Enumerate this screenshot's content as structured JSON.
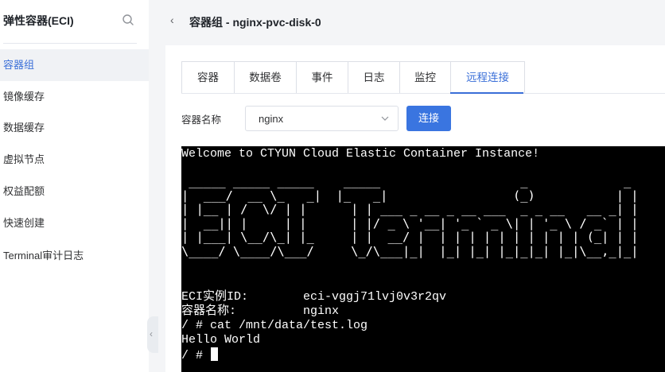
{
  "sidebar": {
    "title": "弹性容器(ECI)",
    "items": [
      {
        "label": "容器组",
        "active": true
      },
      {
        "label": "镜像缓存",
        "active": false
      },
      {
        "label": "数据缓存",
        "active": false
      },
      {
        "label": "虚拟节点",
        "active": false
      },
      {
        "label": "权益配额",
        "active": false
      },
      {
        "label": "快速创建",
        "active": false
      },
      {
        "label": "Terminal审计日志",
        "active": false
      }
    ]
  },
  "header": {
    "title": "容器组 - nginx-pvc-disk-0"
  },
  "tabs": [
    {
      "label": "容器"
    },
    {
      "label": "数据卷"
    },
    {
      "label": "事件"
    },
    {
      "label": "日志"
    },
    {
      "label": "监控"
    },
    {
      "label": "远程连接"
    }
  ],
  "container_select": {
    "label": "容器名称",
    "value": "nginx"
  },
  "connect_button": {
    "label": "连接"
  },
  "terminal": {
    "welcome": "Welcome to CTYUN Cloud Elastic Container Instance!",
    "banner": " _____ _____ _____    _____                   _             _\n|  ___/  __ \\_   _|  |_   _|                 (_)           | |\n| |__ | /  \\/ | |      | | ___ _ __ _ __ ___  _ _ __   __ _| |\n|  __|| |     | |      | |/ _ \\ '__| '_ ` _ \\| | '_ \\ / _` | |\n| |___| \\__/\\_| |_     | |  __/ |  | | | | | | | | | | (_| | |\n\\____/ \\____/\\___/     \\_/\\___|_|  |_| |_| |_|_|_| |_|\\__,_|_|",
    "info_id_label": "ECI实例ID:",
    "info_id_value": "eci-vggj71lvj0v3r2qv",
    "info_name_label": "容器名称:",
    "info_name_value": "nginx",
    "cmd_line": "/ # cat /mnt/data/test.log",
    "output_line": "Hello World",
    "prompt": "/ # "
  }
}
